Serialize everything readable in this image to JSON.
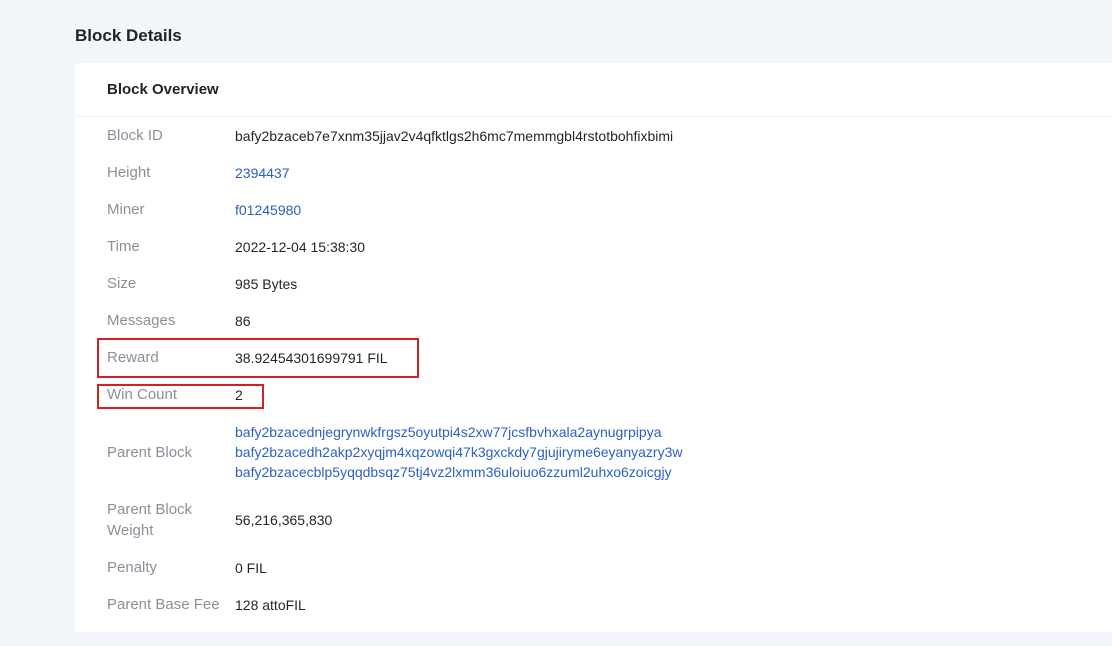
{
  "page": {
    "title": "Block Details"
  },
  "overview": {
    "title": "Block Overview",
    "fields": {
      "block_id": {
        "label": "Block ID",
        "value": "bafy2bzaceb7e7xnm35jjav2v4qfktlgs2h6mc7memmgbl4rstotbohfixbimi"
      },
      "height": {
        "label": "Height",
        "value": "2394437"
      },
      "miner": {
        "label": "Miner",
        "value": "f01245980"
      },
      "time": {
        "label": "Time",
        "value": "2022-12-04 15:38:30"
      },
      "size": {
        "label": "Size",
        "value": "985 Bytes"
      },
      "messages": {
        "label": "Messages",
        "value": "86"
      },
      "reward": {
        "label": "Reward",
        "value": "38.92454301699791 FIL"
      },
      "win_count": {
        "label": "Win Count",
        "value": "2"
      },
      "parent_block": {
        "label": "Parent Block",
        "values": [
          "bafy2bzacednjegrynwkfrgsz5oyutpi4s2xw77jcsfbvhxala2aynugrpipya",
          "bafy2bzacedh2akp2xyqjm4xqzowqi47k3gxckdy7gjujiryme6eyanyazry3w",
          "bafy2bzacecblp5yqqdbsqz75tj4vz2lxmm36uloiuo6zzuml2uhxo6zoicgjy"
        ]
      },
      "parent_block_weight": {
        "label_line1": "Parent Block",
        "label_line2": "Weight",
        "value": "56,216,365,830"
      },
      "penalty": {
        "label": "Penalty",
        "value": "0 FIL"
      },
      "parent_base_fee": {
        "label": "Parent Base Fee",
        "value": "128 attoFIL"
      }
    }
  },
  "colors": {
    "highlight_box": "#d32020",
    "link": "#2c5fc4",
    "label": "#8a8f99",
    "background": "#f2f5fa"
  }
}
